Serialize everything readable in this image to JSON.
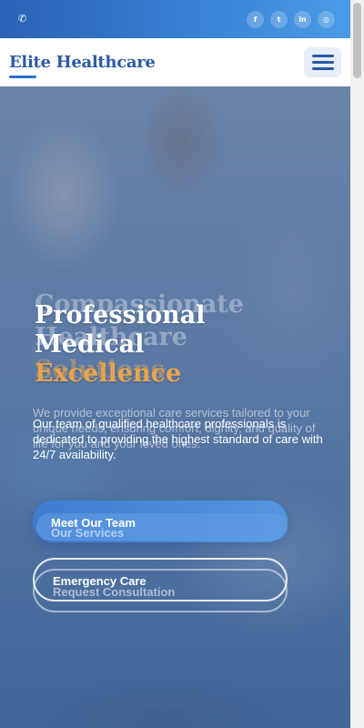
{
  "topbar": {
    "phone_icon": "phone-icon",
    "socials": [
      {
        "icon": "facebook-icon",
        "glyph": "f"
      },
      {
        "icon": "twitter-icon",
        "glyph": "t"
      },
      {
        "icon": "linkedin-icon",
        "glyph": "in"
      },
      {
        "icon": "instagram-icon",
        "glyph": "◎"
      }
    ]
  },
  "header": {
    "brand": "Elite Healthcare",
    "menu_icon": "hamburger-menu-icon"
  },
  "hero": {
    "ghost_title_line1": "Compassionate",
    "ghost_title_line2": "Healthcare",
    "ghost_title_line3": "Solutions",
    "ghost_text": "We provide exceptional care services tailored to your unique needs, ensuring comfort, dignity, and quality of life for you and your loved ones.",
    "title_line1": "Professional",
    "title_line2": "Medical",
    "title_accent": "Excellence",
    "text": "Our team of qualified healthcare professionals is dedicated to providing the highest standard of care with 24/7 availability.",
    "primary_button": "Meet Our Team",
    "primary_button_ghost": "Our Services",
    "secondary_button": "Emergency Care",
    "secondary_button_ghost": "Request Consultation"
  },
  "colors": {
    "brand": "#2b5aa6",
    "accent": "#e9a34d",
    "topbar": "#3a84d6"
  }
}
